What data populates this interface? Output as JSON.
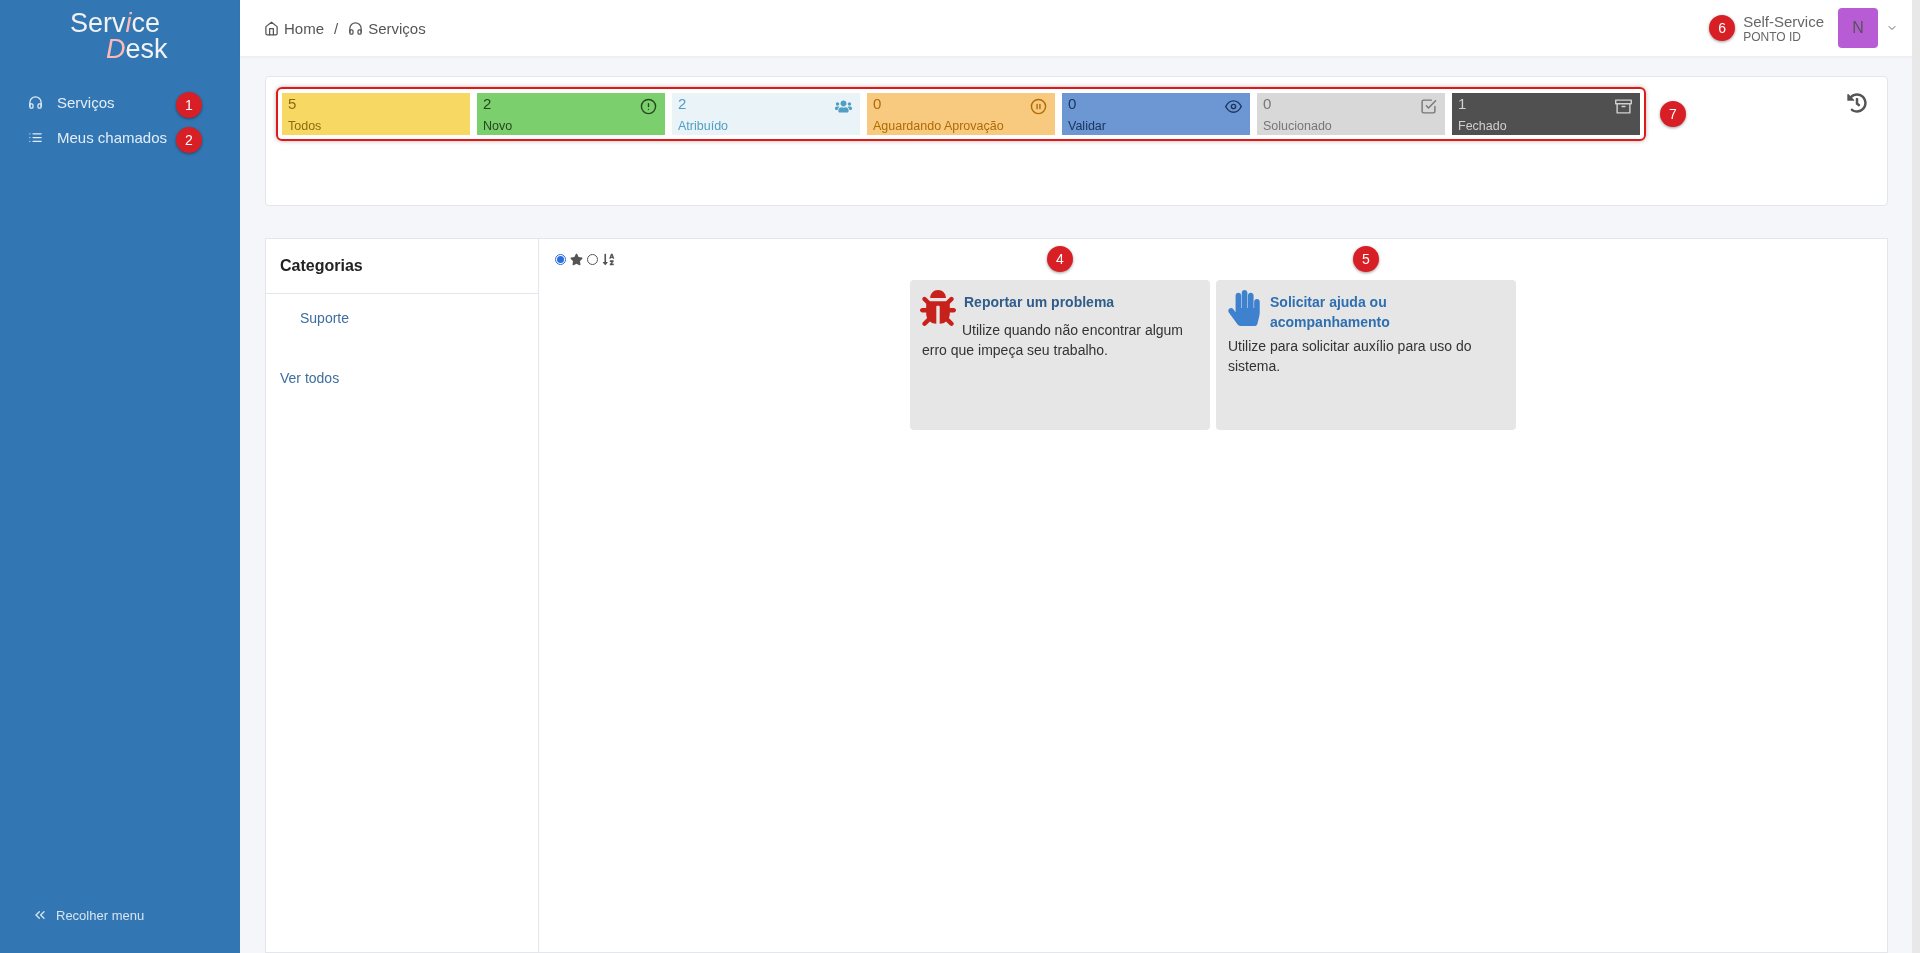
{
  "sidebar": {
    "logo": {
      "line1": [
        {
          "text": "Serv",
          "accent": false
        },
        {
          "text": "i",
          "accent": true
        },
        {
          "text": "ce",
          "accent": false
        }
      ],
      "line2": [
        {
          "text": "D",
          "accent": true
        },
        {
          "text": "esk",
          "accent": false
        }
      ]
    },
    "items": [
      {
        "label": "Serviços",
        "kind": "headset",
        "marker": "1"
      },
      {
        "label": "Meus chamados",
        "kind": "list",
        "marker": "2"
      }
    ],
    "collapse": "Recolher menu"
  },
  "breadcrumb": {
    "separator": "/",
    "items": [
      {
        "label": "Home",
        "kind": "home"
      },
      {
        "label": "Serviços",
        "kind": "headset"
      }
    ]
  },
  "user": {
    "name": "Self-Service",
    "org": "PONTO ID",
    "avatar": "N",
    "marker": "6"
  },
  "status_tiles": {
    "marker": "7",
    "tiles": [
      {
        "count": "5",
        "label": "Todos",
        "kind": "none",
        "color": "#f7d862"
      },
      {
        "count": "2",
        "label": "Novo",
        "kind": "alert",
        "color": "#7bcf6d"
      },
      {
        "count": "2",
        "label": "Atribuído",
        "kind": "users",
        "color": "#eaf3f7"
      },
      {
        "count": "0",
        "label": "Aguardando Aprovação",
        "kind": "pause",
        "color": "#f7ca80"
      },
      {
        "count": "0",
        "label": "Validar",
        "kind": "eye",
        "color": "#6c97d3"
      },
      {
        "count": "0",
        "label": "Solucionado",
        "kind": "check",
        "color": "#d8d8d8"
      },
      {
        "count": "1",
        "label": "Fechado",
        "kind": "archive",
        "color": "#505050"
      }
    ]
  },
  "categories": {
    "title": "Categorias",
    "items": [
      "Suporte"
    ],
    "see_all": "Ver todos"
  },
  "view_options": [
    {
      "kind": "star",
      "selected": true
    },
    {
      "kind": "sort",
      "selected": false
    }
  ],
  "services": [
    {
      "title": "Reportar um problema",
      "description": "Utilize quando não encontrar algum erro que impeça seu trabalho.",
      "kind": "bug",
      "marker": "4"
    },
    {
      "title": "Solicitar ajuda ou acompanhamento",
      "description": "Utilize para solicitar auxílio para uso do sistema.",
      "kind": "hand",
      "marker": "5"
    }
  ]
}
